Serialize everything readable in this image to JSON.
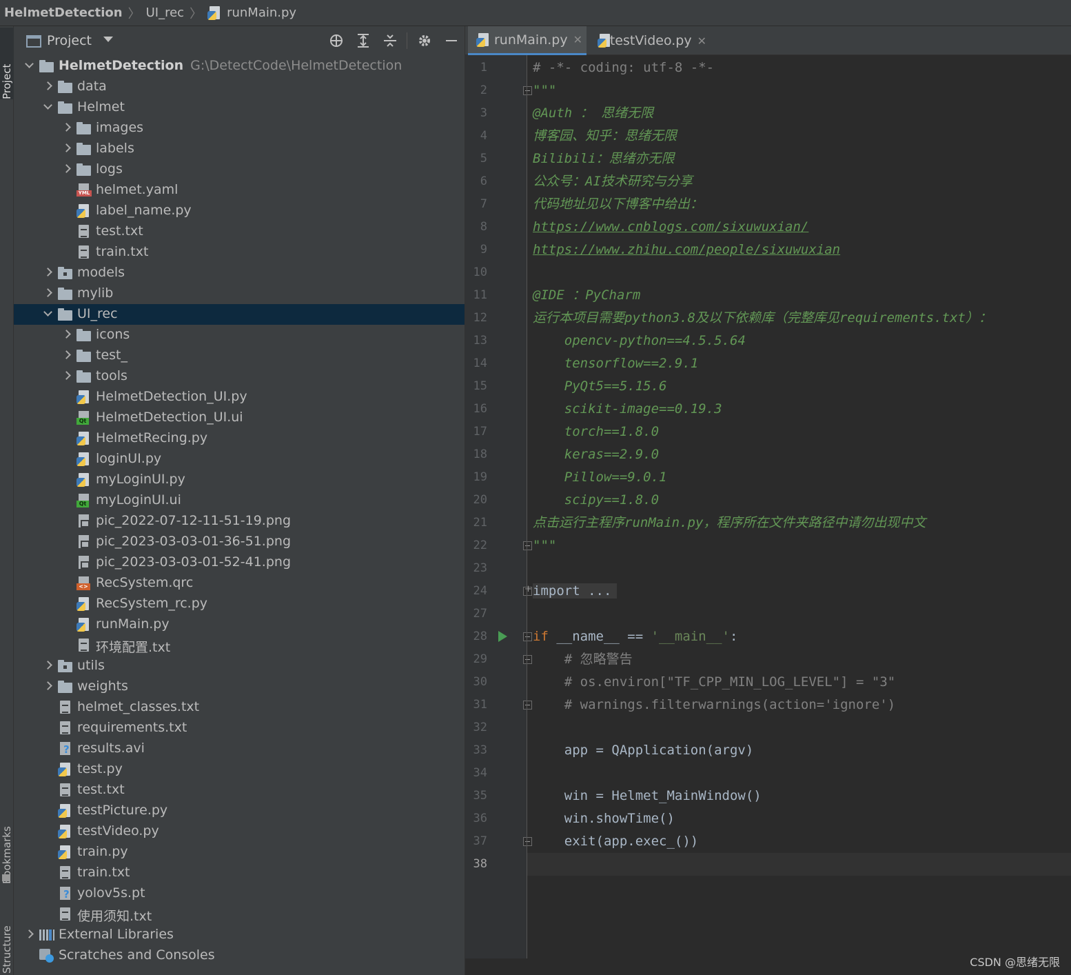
{
  "breadcrumb": {
    "project": "HelmetDetection",
    "folder": "UI_rec",
    "file": "runMain.py"
  },
  "side_stripe": {
    "project": "Project",
    "bookmarks": "Bookmarks",
    "structure": "Structure"
  },
  "project_panel": {
    "title": "Project",
    "tools": [
      "locate-icon",
      "expand-all-icon",
      "collapse-all-icon",
      "gear-icon",
      "minimize-icon"
    ]
  },
  "tree": [
    {
      "label": "HelmetDetection",
      "path": "G:\\DetectCode\\HelmetDetection",
      "depth": 0,
      "type": "folder",
      "arrow": "expanded",
      "bold": true
    },
    {
      "label": "data",
      "depth": 1,
      "type": "folder",
      "arrow": "collapsed"
    },
    {
      "label": "Helmet",
      "depth": 1,
      "type": "folder",
      "arrow": "expanded"
    },
    {
      "label": "images",
      "depth": 2,
      "type": "folder",
      "arrow": "collapsed"
    },
    {
      "label": "labels",
      "depth": 2,
      "type": "folder",
      "arrow": "collapsed"
    },
    {
      "label": "logs",
      "depth": 2,
      "type": "folder",
      "arrow": "collapsed"
    },
    {
      "label": "helmet.yaml",
      "depth": 2,
      "type": "yml"
    },
    {
      "label": "label_name.py",
      "depth": 2,
      "type": "py"
    },
    {
      "label": "test.txt",
      "depth": 2,
      "type": "txt"
    },
    {
      "label": "train.txt",
      "depth": 2,
      "type": "txt"
    },
    {
      "label": "models",
      "depth": 1,
      "type": "folder-mod",
      "arrow": "collapsed"
    },
    {
      "label": "mylib",
      "depth": 1,
      "type": "folder",
      "arrow": "collapsed"
    },
    {
      "label": "UI_rec",
      "depth": 1,
      "type": "folder",
      "arrow": "expanded",
      "selected": true
    },
    {
      "label": "icons",
      "depth": 2,
      "type": "folder",
      "arrow": "collapsed"
    },
    {
      "label": "test_",
      "depth": 2,
      "type": "folder",
      "arrow": "collapsed"
    },
    {
      "label": "tools",
      "depth": 2,
      "type": "folder",
      "arrow": "collapsed"
    },
    {
      "label": "HelmetDetection_UI.py",
      "depth": 2,
      "type": "py"
    },
    {
      "label": "HelmetDetection_UI.ui",
      "depth": 2,
      "type": "ui"
    },
    {
      "label": "HelmetRecing.py",
      "depth": 2,
      "type": "py"
    },
    {
      "label": "loginUI.py",
      "depth": 2,
      "type": "py"
    },
    {
      "label": "myLoginUI.py",
      "depth": 2,
      "type": "py"
    },
    {
      "label": "myLoginUI.ui",
      "depth": 2,
      "type": "ui"
    },
    {
      "label": "pic_2022-07-12-11-51-19.png",
      "depth": 2,
      "type": "png"
    },
    {
      "label": "pic_2023-03-03-01-36-51.png",
      "depth": 2,
      "type": "png"
    },
    {
      "label": "pic_2023-03-03-01-52-41.png",
      "depth": 2,
      "type": "png"
    },
    {
      "label": "RecSystem.qrc",
      "depth": 2,
      "type": "qrc"
    },
    {
      "label": "RecSystem_rc.py",
      "depth": 2,
      "type": "py"
    },
    {
      "label": "runMain.py",
      "depth": 2,
      "type": "py"
    },
    {
      "label": "环境配置.txt",
      "depth": 2,
      "type": "txt"
    },
    {
      "label": "utils",
      "depth": 1,
      "type": "folder-mod",
      "arrow": "collapsed"
    },
    {
      "label": "weights",
      "depth": 1,
      "type": "folder",
      "arrow": "collapsed"
    },
    {
      "label": "helmet_classes.txt",
      "depth": 1,
      "type": "txt"
    },
    {
      "label": "requirements.txt",
      "depth": 1,
      "type": "txt"
    },
    {
      "label": "results.avi",
      "depth": 1,
      "type": "unk"
    },
    {
      "label": "test.py",
      "depth": 1,
      "type": "py"
    },
    {
      "label": "test.txt",
      "depth": 1,
      "type": "txt"
    },
    {
      "label": "testPicture.py",
      "depth": 1,
      "type": "py"
    },
    {
      "label": "testVideo.py",
      "depth": 1,
      "type": "py"
    },
    {
      "label": "train.py",
      "depth": 1,
      "type": "py"
    },
    {
      "label": "train.txt",
      "depth": 1,
      "type": "txt"
    },
    {
      "label": "yolov5s.pt",
      "depth": 1,
      "type": "unk"
    },
    {
      "label": "使用须知.txt",
      "depth": 1,
      "type": "txt"
    },
    {
      "label": "External Libraries",
      "depth": 0,
      "type": "lib",
      "arrow": "collapsed"
    },
    {
      "label": "Scratches and Consoles",
      "depth": 0,
      "type": "scr"
    }
  ],
  "editor": {
    "tabs": [
      {
        "label": "runMain.py",
        "active": true
      },
      {
        "label": "testVideo.py",
        "active": false
      }
    ],
    "current_line": "38",
    "lines": [
      {
        "n": "1",
        "parts": [
          {
            "t": "# -*- coding: utf-8 -*-",
            "c": "cm"
          }
        ]
      },
      {
        "n": "2",
        "fold": "minus",
        "parts": [
          {
            "t": "\"\"\"",
            "c": "doc"
          }
        ]
      },
      {
        "n": "3",
        "parts": [
          {
            "t": "@Auth ： 思绪无限",
            "c": "doc"
          }
        ]
      },
      {
        "n": "4",
        "parts": [
          {
            "t": "博客园、知乎：思绪无限",
            "c": "doc"
          }
        ]
      },
      {
        "n": "5",
        "parts": [
          {
            "t": "Bilibili：思绪亦无限",
            "c": "doc"
          }
        ]
      },
      {
        "n": "6",
        "parts": [
          {
            "t": "公众号：AI技术研究与分享",
            "c": "doc"
          }
        ]
      },
      {
        "n": "7",
        "parts": [
          {
            "t": "代码地址见以下博客中给出：",
            "c": "doc"
          }
        ]
      },
      {
        "n": "8",
        "parts": [
          {
            "t": "https://www.cnblogs.com/sixuwuxian/",
            "c": "doc url"
          }
        ]
      },
      {
        "n": "9",
        "parts": [
          {
            "t": "https://www.zhihu.com/people/sixuwuxian",
            "c": "doc url"
          }
        ]
      },
      {
        "n": "10",
        "parts": []
      },
      {
        "n": "11",
        "parts": [
          {
            "t": "@IDE ：PyCharm",
            "c": "doc"
          }
        ]
      },
      {
        "n": "12",
        "parts": [
          {
            "t": "运行本项目需要python3.8及以下依赖库（完整库见requirements.txt）：",
            "c": "doc"
          }
        ]
      },
      {
        "n": "13",
        "parts": [
          {
            "t": "    opencv-python==4.5.5.64",
            "c": "doc"
          }
        ]
      },
      {
        "n": "14",
        "parts": [
          {
            "t": "    tensorflow==2.9.1",
            "c": "doc"
          }
        ]
      },
      {
        "n": "15",
        "parts": [
          {
            "t": "    PyQt5==5.15.6",
            "c": "doc"
          }
        ]
      },
      {
        "n": "16",
        "parts": [
          {
            "t": "    scikit-image==0.19.3",
            "c": "doc"
          }
        ]
      },
      {
        "n": "17",
        "parts": [
          {
            "t": "    torch==1.8.0",
            "c": "doc"
          }
        ]
      },
      {
        "n": "18",
        "parts": [
          {
            "t": "    keras==2.9.0",
            "c": "doc"
          }
        ]
      },
      {
        "n": "19",
        "parts": [
          {
            "t": "    Pillow==9.0.1",
            "c": "doc"
          }
        ]
      },
      {
        "n": "20",
        "parts": [
          {
            "t": "    scipy==1.8.0",
            "c": "doc"
          }
        ]
      },
      {
        "n": "21",
        "parts": [
          {
            "t": "点击运行主程序runMain.py，程序所在文件夹路径中请勿出现中文",
            "c": "doc"
          }
        ]
      },
      {
        "n": "22",
        "fold": "minus",
        "parts": [
          {
            "t": "\"\"\"",
            "c": "doc"
          }
        ]
      },
      {
        "n": "23",
        "parts": []
      },
      {
        "n": "24",
        "fold": "plus",
        "parts": [
          {
            "t": "import ...",
            "c": "folded"
          }
        ]
      },
      {
        "n": "27",
        "parts": []
      },
      {
        "n": "28",
        "fold": "minus",
        "run": true,
        "parts": [
          {
            "t": "if",
            "c": "kw"
          },
          {
            "t": " __name__ == ",
            "c": "plain"
          },
          {
            "t": "'__main__'",
            "c": "str"
          },
          {
            "t": ":",
            "c": "plain"
          }
        ]
      },
      {
        "n": "29",
        "fold": "minus",
        "parts": [
          {
            "t": "    # 忽略警告",
            "c": "cm"
          }
        ]
      },
      {
        "n": "30",
        "parts": [
          {
            "t": "    # os.environ[\"TF_CPP_MIN_LOG_LEVEL\"] = \"3\"",
            "c": "cm"
          }
        ]
      },
      {
        "n": "31",
        "fold": "minus",
        "parts": [
          {
            "t": "    # warnings.filterwarnings(action='ignore')",
            "c": "cm"
          }
        ]
      },
      {
        "n": "32",
        "parts": []
      },
      {
        "n": "33",
        "parts": [
          {
            "t": "    app = QApplication(argv)",
            "c": "plain"
          }
        ]
      },
      {
        "n": "34",
        "parts": []
      },
      {
        "n": "35",
        "parts": [
          {
            "t": "    win = Helmet_MainWindow()",
            "c": "plain"
          }
        ]
      },
      {
        "n": "36",
        "parts": [
          {
            "t": "    win.showTime()",
            "c": "plain"
          }
        ]
      },
      {
        "n": "37",
        "fold": "minus",
        "parts": [
          {
            "t": "    exit(app.exec_())",
            "c": "plain"
          }
        ]
      },
      {
        "n": "38",
        "parts": []
      }
    ]
  },
  "watermark": "CSDN @思绪无限"
}
